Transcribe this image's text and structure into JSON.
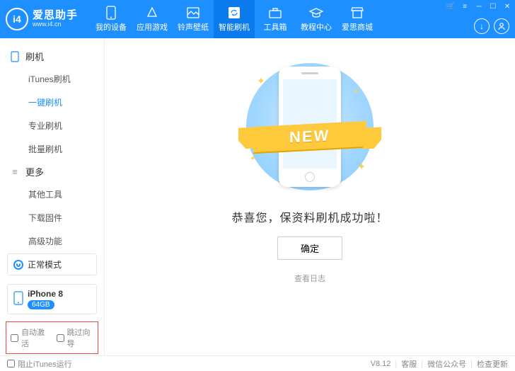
{
  "app": {
    "name": "爱思助手",
    "url": "www.i4.cn"
  },
  "topnav": [
    {
      "label": "我的设备"
    },
    {
      "label": "应用游戏"
    },
    {
      "label": "铃声壁纸"
    },
    {
      "label": "智能刷机"
    },
    {
      "label": "工具箱"
    },
    {
      "label": "教程中心"
    },
    {
      "label": "爱思商城"
    }
  ],
  "sidebar": {
    "group1": {
      "title": "刷机",
      "items": [
        "iTunes刷机",
        "一键刷机",
        "专业刷机",
        "批量刷机"
      ]
    },
    "group2": {
      "title": "更多",
      "items": [
        "其他工具",
        "下载固件",
        "高级功能"
      ]
    },
    "mode": "正常模式",
    "device": {
      "name": "iPhone 8",
      "storage": "64GB"
    },
    "checks": {
      "autoActivate": "自动激活",
      "skipSetup": "跳过向导"
    }
  },
  "main": {
    "ribbon": "NEW",
    "message": "恭喜您，保资料刷机成功啦！",
    "okBtn": "确定",
    "logLink": "查看日志"
  },
  "status": {
    "blockItunes": "阻止iTunes运行",
    "version": "V8.12",
    "support": "客服",
    "wechat": "微信公众号",
    "update": "检查更新"
  }
}
